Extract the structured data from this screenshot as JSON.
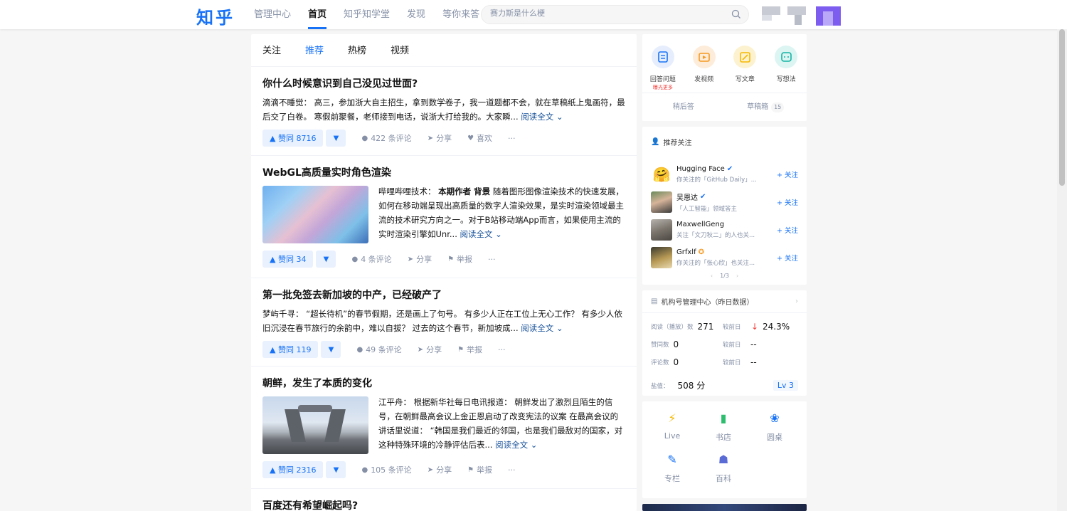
{
  "header": {
    "logo": "知乎",
    "nav": [
      "管理中心",
      "首页",
      "知乎知学堂",
      "发现",
      "等你来答"
    ],
    "active_nav": 1,
    "search_placeholder": "赛力斯是什么梗"
  },
  "feed": {
    "tabs": [
      "关注",
      "推荐",
      "热榜",
      "视频"
    ],
    "active_tab": 1,
    "read_more": "阅读全文",
    "cards": [
      {
        "title": "你什么时候意识到自己没见过世面?",
        "author": "滴滴不睡觉：",
        "excerpt": "高三，参加浙大自主招生，拿到数学卷子，我一道题都不会，就在草稿纸上鬼画符，最后交了白卷。 寒假前聚餐，老师接到电话，说浙大打给我的。大家瞬...",
        "vote": "▲ 赞同 8716",
        "comments": "422 条评论",
        "share": "分享",
        "extra": "喜欢"
      },
      {
        "title": "WebGL高质量实时角色渲染",
        "author": "哔哩哔哩技术：",
        "bold": "本期作者 背景",
        "excerpt": "随着图形图像渲染技术的快速发展，如何在移动端呈现出高质量的数字人渲染效果，是实时渲染领域最主流的技术研究方向之一。对于B站移动端App而言，如果使用主流的实时渲染引擎如Unr...",
        "vote": "▲ 赞同 34",
        "comments": "4 条评论",
        "share": "分享",
        "extra": "举报"
      },
      {
        "title": "第一批免签去新加坡的中产，已经破产了",
        "author": "梦屿千寻：",
        "excerpt": "“超长待机”的春节假期，还是画上了句号。 有多少人正在工位上无心工作？ 有多少人依旧沉浸在春节旅行的余韵中，难以自拔？ 过去的这个春节，新加坡成...",
        "vote": "▲ 赞同 119",
        "comments": "49 条评论",
        "share": "分享",
        "extra": "举报"
      },
      {
        "title": "朝鲜，发生了本质的变化",
        "author": "江平舟：",
        "excerpt": "根据新华社每日电讯报道： 朝鲜发出了激烈且陌生的信号，在朝鲜最高会议上金正恩启动了改变宪法的议案 在最高会议的讲话里说道： “韩国是我们最近的邻国，也是我们最敌对的国家，对这种特殊环境的冷静评估后表...",
        "vote": "▲ 赞同 2316",
        "comments": "105 条评论",
        "share": "分享",
        "extra": "举报"
      },
      {
        "title": "百度还有希望崛起吗?"
      }
    ]
  },
  "creator": {
    "items": [
      {
        "label": "回答问题",
        "sub": "曝光更多"
      },
      {
        "label": "发视频"
      },
      {
        "label": "写文章"
      },
      {
        "label": "写想法"
      }
    ],
    "later": "稍后答",
    "drafts": "草稿箱",
    "drafts_count": "15"
  },
  "recommend": {
    "title": "推荐关注",
    "follow": "+ 关注",
    "pager": "1/3",
    "users": [
      {
        "name": "Hugging Face",
        "desc": "你关注的「GitHub Daily」..."
      },
      {
        "name": "吴恩达",
        "desc": "「人工智能」领域答主"
      },
      {
        "name": "MaxwellGeng",
        "desc": "关注「文刀秋二」的人也关..."
      },
      {
        "name": "Grfxlf",
        "desc": "你关注的「张心欣」也关注..."
      }
    ]
  },
  "stats": {
    "title": "机构号管理中心（昨日数据）",
    "rows": [
      {
        "label": "阅读（播放）数",
        "value": "271",
        "cmp": "较前日",
        "delta": "24.3%"
      },
      {
        "label": "赞同数",
        "value": "0",
        "cmp": "较前日",
        "delta": "--"
      },
      {
        "label": "评论数",
        "value": "0",
        "cmp": "较前日",
        "delta": "--"
      }
    ],
    "salt_label": "盐值：",
    "salt_value": "508 分",
    "level": "Lv 3"
  },
  "tools": [
    "Live",
    "书店",
    "圆桌",
    "专栏",
    "百科"
  ],
  "colors": {
    "brand": "#1772f6",
    "bg": "#f6f6f6"
  }
}
